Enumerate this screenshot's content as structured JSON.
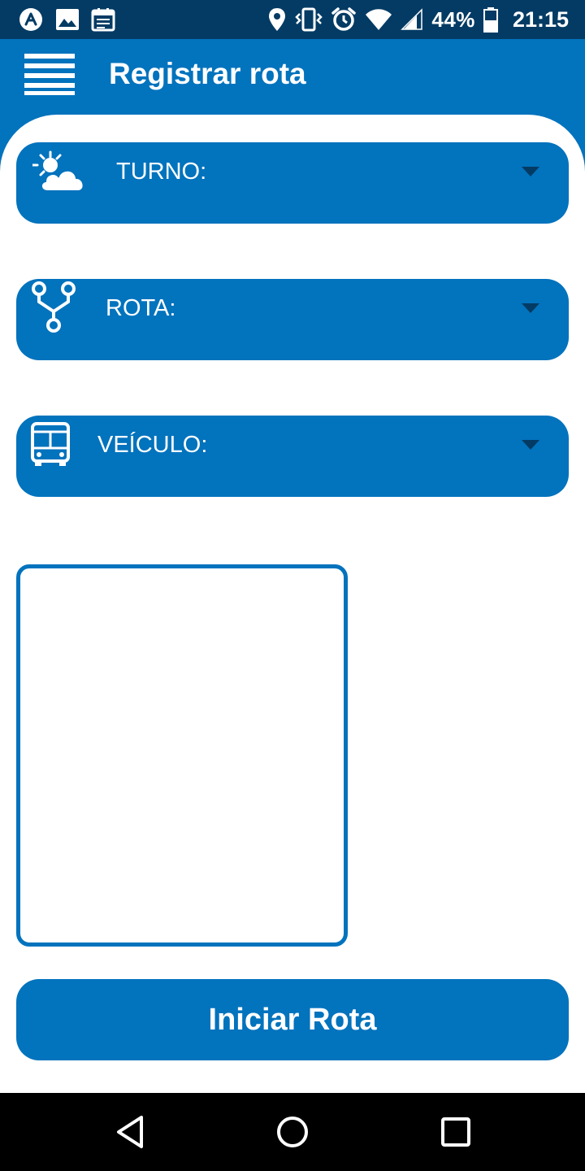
{
  "status_bar": {
    "left_icons": [
      "app-notification-icon",
      "image-icon",
      "calendar-icon"
    ],
    "right_icons": [
      "location-icon",
      "vibrate-icon",
      "alarm-icon",
      "wifi-icon",
      "signal-icon",
      "battery-icon"
    ],
    "battery": "44%",
    "time": "21:15"
  },
  "app_bar": {
    "menu_icon": "menu-icon",
    "title": "Registrar rota"
  },
  "form": {
    "turno": {
      "icon": "partly-cloudy-icon",
      "label": "TURNO:",
      "value": ""
    },
    "rota": {
      "icon": "route-fork-icon",
      "label": "ROTA:",
      "value": ""
    },
    "veiculo": {
      "icon": "bus-icon",
      "label": "VEÍCULO:",
      "value": ""
    }
  },
  "start_button": {
    "label": "Iniciar Rota"
  },
  "nav_bar": {
    "icons": [
      "back-icon",
      "home-icon",
      "recents-icon"
    ]
  },
  "colors": {
    "primary": "#0273bd",
    "status_bar": "#033b64",
    "background": "#ffffff",
    "nav_bar": "#000000"
  }
}
